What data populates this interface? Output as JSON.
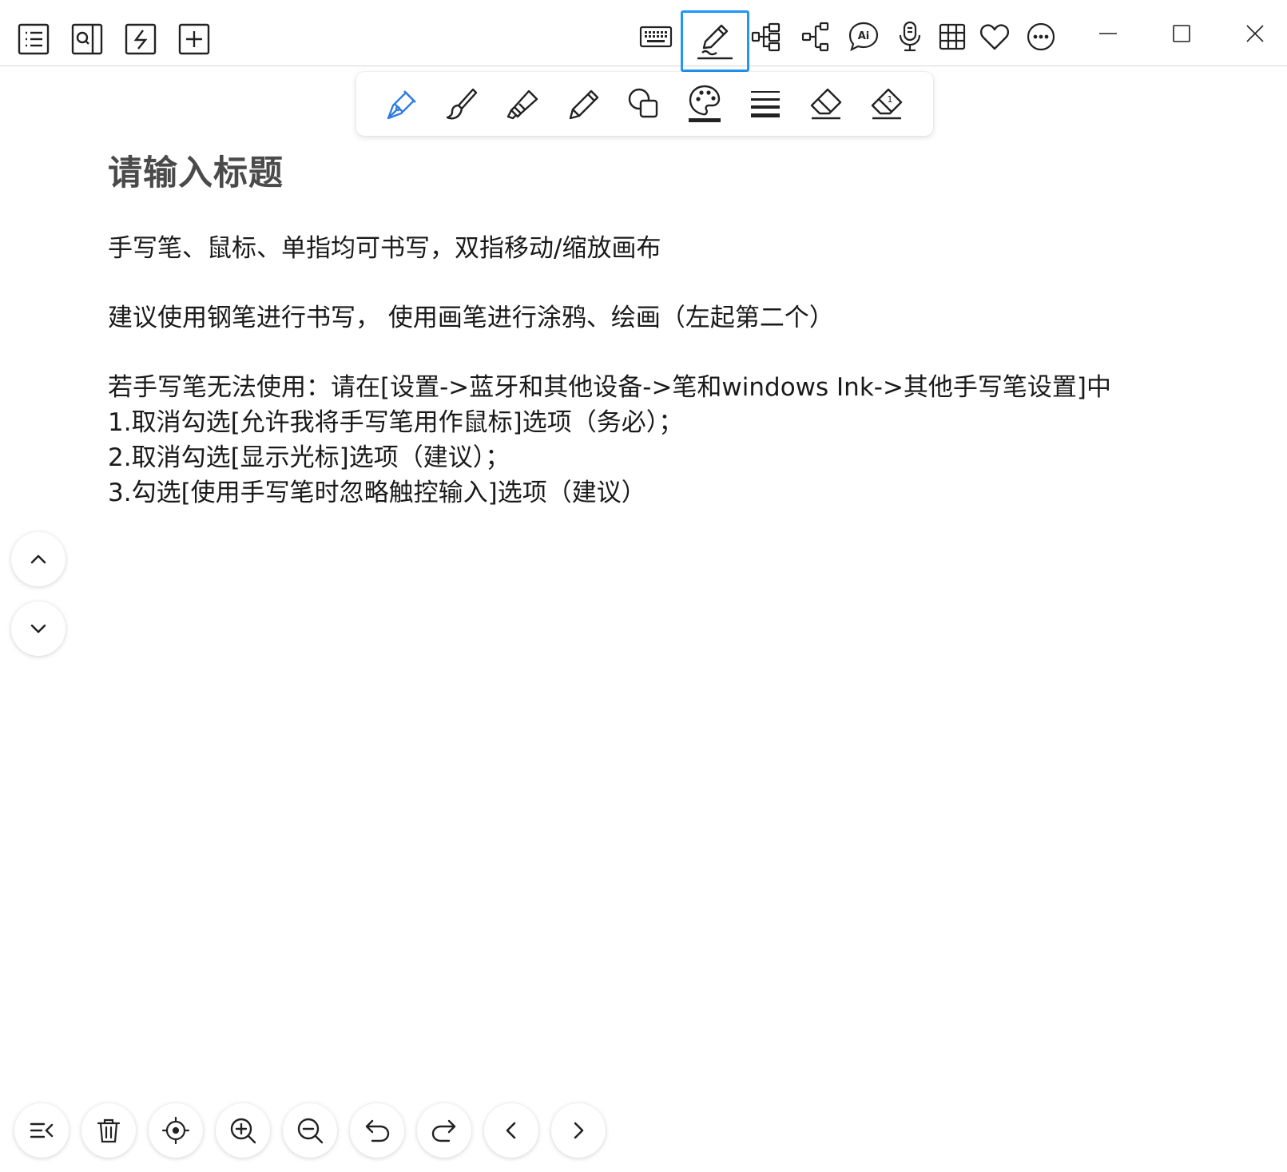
{
  "toolbar_left": {
    "icons": [
      "list-icon",
      "search-panel-icon",
      "flash-icon",
      "add-icon"
    ]
  },
  "toolbar_right": {
    "icons": [
      "keyboard-icon",
      "handwriting-pen-icon",
      "mindmap-icon",
      "flowchart-icon",
      "ai-chat-icon",
      "microphone-icon",
      "table-icon",
      "heart-icon",
      "more-icon"
    ],
    "active": "handwriting-pen-icon",
    "active_color": "#2196f3"
  },
  "window_controls": [
    "minimize-icon",
    "maximize-icon",
    "close-icon"
  ],
  "pen_toolbar": {
    "tools": [
      "fountain-pen-icon",
      "brush-icon",
      "highlighter-icon",
      "pencil-icon",
      "shapes-icon",
      "color-palette-icon",
      "stroke-width-icon",
      "eraser-icon",
      "stroke-eraser-icon"
    ],
    "selected": "fountain-pen-icon",
    "selected_color": "#2f7de1"
  },
  "document": {
    "title": "请输入标题",
    "lines": [
      "手写笔、鼠标、单指均可书写，双指移动/缩放画布",
      "建议使用钢笔进行书写， 使用画笔进行涂鸦、绘画（左起第二个）",
      "若手写笔无法使用：请在[设置->蓝牙和其他设备->笔和windows Ink->其他手写笔设置]中",
      "1.取消勾选[允许我将手写笔用作鼠标]选项（务必）；",
      "2.取消勾选[显示光标]选项（建议）；",
      "3.勾选[使用手写笔时忽略触控输入]选项（建议）"
    ]
  },
  "side_nav": [
    "chevron-up-icon",
    "chevron-down-icon"
  ],
  "bottom_bar": [
    "collapse-menu-icon",
    "trash-icon",
    "locate-icon",
    "zoom-in-icon",
    "zoom-out-icon",
    "undo-icon",
    "redo-icon",
    "chevron-left-icon",
    "chevron-right-icon"
  ]
}
